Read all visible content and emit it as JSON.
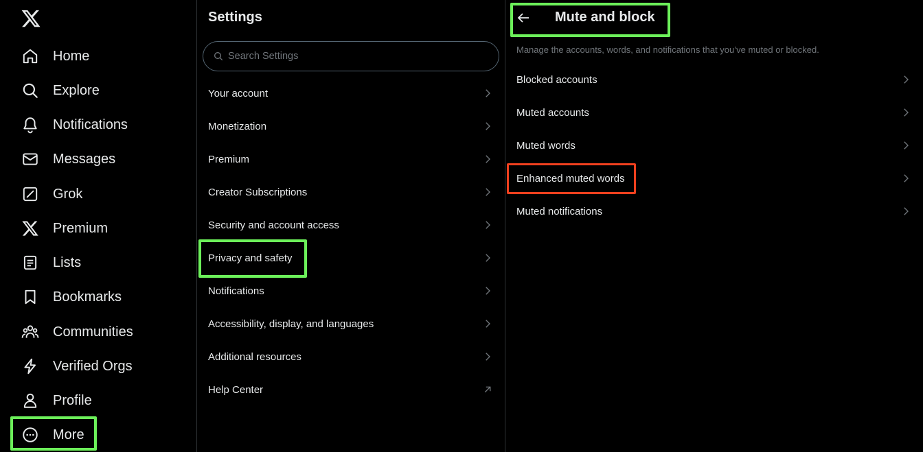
{
  "nav": {
    "logo": "x-logo-icon",
    "items": [
      {
        "label": "Home",
        "icon": "home-icon"
      },
      {
        "label": "Explore",
        "icon": "search-icon"
      },
      {
        "label": "Notifications",
        "icon": "bell-icon"
      },
      {
        "label": "Messages",
        "icon": "envelope-icon"
      },
      {
        "label": "Grok",
        "icon": "grok-icon"
      },
      {
        "label": "Premium",
        "icon": "x-logo-icon"
      },
      {
        "label": "Lists",
        "icon": "list-icon"
      },
      {
        "label": "Bookmarks",
        "icon": "bookmark-icon"
      },
      {
        "label": "Communities",
        "icon": "people-icon"
      },
      {
        "label": "Verified Orgs",
        "icon": "lightning-icon"
      },
      {
        "label": "Profile",
        "icon": "person-icon"
      },
      {
        "label": "More",
        "icon": "more-circle-icon"
      }
    ]
  },
  "settings": {
    "title": "Settings",
    "search_placeholder": "Search Settings",
    "items": [
      {
        "label": "Your account",
        "icon": "chevron-right-icon"
      },
      {
        "label": "Monetization",
        "icon": "chevron-right-icon"
      },
      {
        "label": "Premium",
        "icon": "chevron-right-icon"
      },
      {
        "label": "Creator Subscriptions",
        "icon": "chevron-right-icon"
      },
      {
        "label": "Security and account access",
        "icon": "chevron-right-icon"
      },
      {
        "label": "Privacy and safety",
        "icon": "chevron-right-icon"
      },
      {
        "label": "Notifications",
        "icon": "chevron-right-icon"
      },
      {
        "label": "Accessibility, display, and languages",
        "icon": "chevron-right-icon"
      },
      {
        "label": "Additional resources",
        "icon": "chevron-right-icon"
      },
      {
        "label": "Help Center",
        "icon": "external-link-icon"
      }
    ]
  },
  "mute": {
    "title": "Mute and block",
    "description": "Manage the accounts, words, and notifications that you’ve muted or blocked.",
    "items": [
      {
        "label": "Blocked accounts"
      },
      {
        "label": "Muted accounts"
      },
      {
        "label": "Muted words"
      },
      {
        "label": "Enhanced muted words"
      },
      {
        "label": "Muted notifications"
      }
    ]
  },
  "colors": {
    "background": "#000000",
    "text": "#e7e9ea",
    "secondary_text": "#71767b",
    "divider": "#2f3336",
    "highlight_green": "#6cf05a",
    "highlight_red": "#f0401e"
  }
}
